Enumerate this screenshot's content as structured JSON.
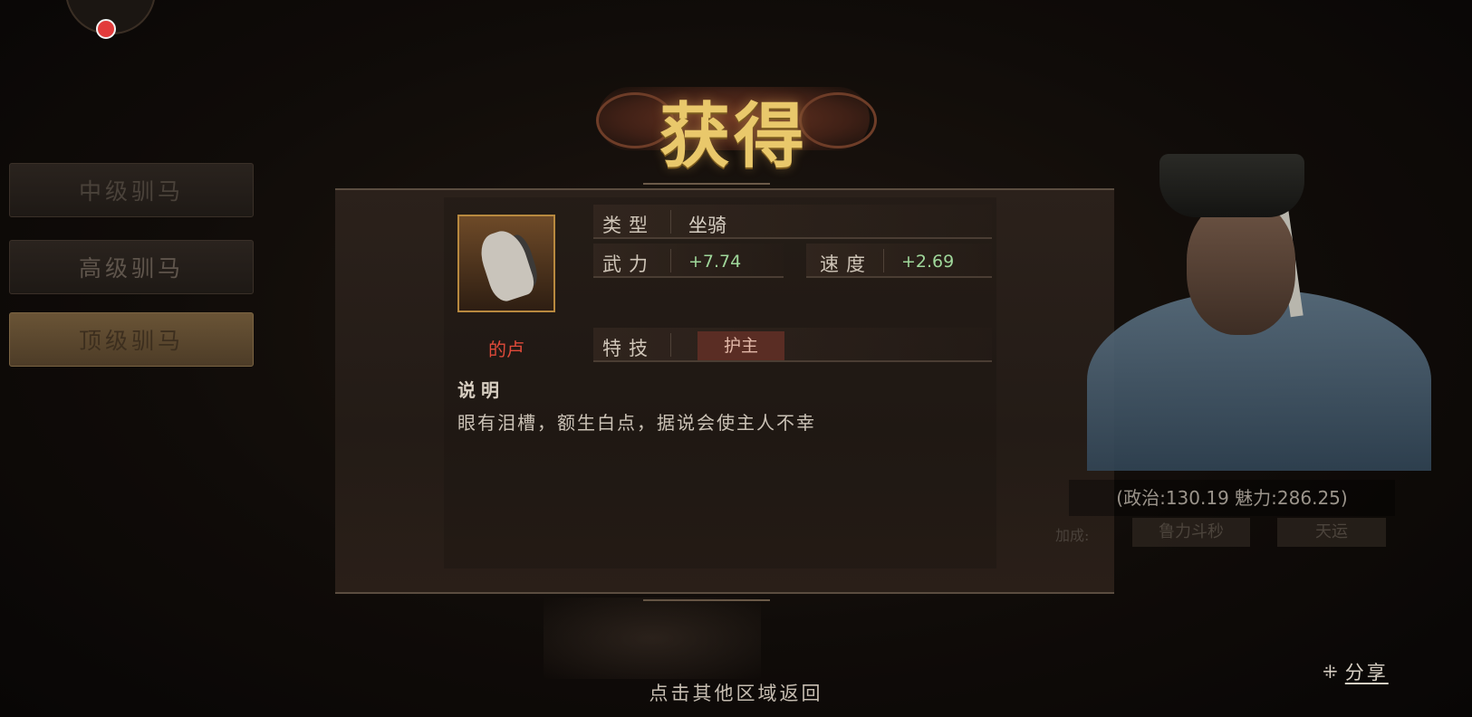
{
  "title": "获得",
  "side_menu": [
    {
      "label": "中级驯马"
    },
    {
      "label": "高级驯马"
    },
    {
      "label": "顶级驯马"
    }
  ],
  "item": {
    "name": "的卢",
    "type_label": "类型",
    "type_value": "坐骑",
    "attrs": [
      {
        "label": "武力",
        "value": "+7.74"
      },
      {
        "label": "速度",
        "value": "+2.69"
      }
    ],
    "skill_label": "特技",
    "skill_value": "护主",
    "desc_label": "说明",
    "desc_text": "眼有泪槽，额生白点，据说会使主人不幸"
  },
  "character": {
    "stats": "(政治:130.19 魅力:286.25)",
    "bonus_label": "加成:",
    "bonus_chips": [
      "鲁力斗秒",
      "天运"
    ]
  },
  "share_label": "分享",
  "hint": "点击其他区域返回",
  "colors": {
    "title_gold": "#e9c86b",
    "name_red": "#e04a3a",
    "value_green": "#9fd79a",
    "selected_menu": "#6a5436"
  },
  "icons": {
    "share": "share-icon",
    "red_dot": "notification-dot"
  }
}
